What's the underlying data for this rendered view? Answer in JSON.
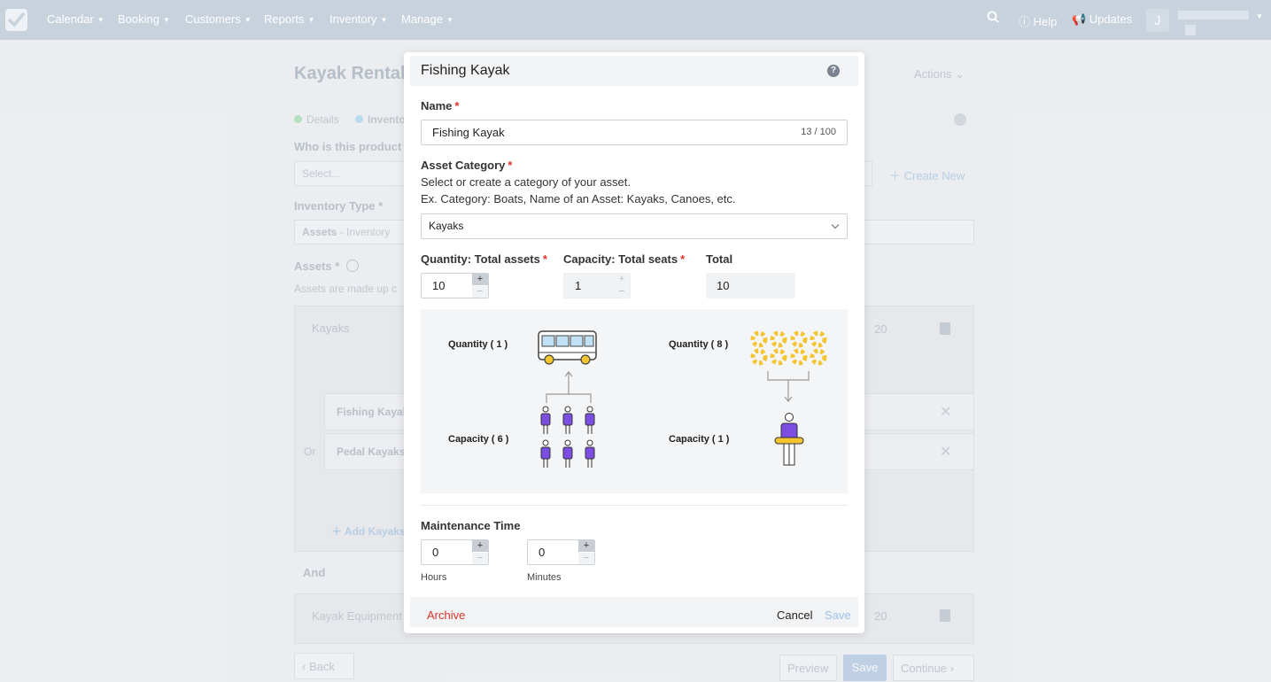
{
  "nav": {
    "items": [
      {
        "label": "Calendar"
      },
      {
        "label": "Booking"
      },
      {
        "label": "Customers"
      },
      {
        "label": "Reports"
      },
      {
        "label": "Inventory"
      },
      {
        "label": "Manage"
      }
    ],
    "help_label": "Help",
    "updates_label": "Updates",
    "user_initial": "J"
  },
  "background": {
    "title": "Kayak Rentals",
    "actions_label": "Actions",
    "steps": [
      {
        "label": "Details"
      },
      {
        "label": "Invento"
      }
    ],
    "who_label": "Who is this product",
    "select_placeholder": "Select...",
    "create_new_label": "Create New",
    "inventory_type_label": "Inventory Type *",
    "inventory_type_value": "Assets",
    "inventory_type_rest": " - Inventory",
    "assets_label": "Assets *",
    "assets_help": "Assets are made up c",
    "kayaks_group": "Kayaks",
    "kayaks_count": "20",
    "fishing_kayak": "Fishing Kayak",
    "pedal_kayaks": "Pedal Kayaks",
    "or_label": "Or",
    "add_kayaks_label": "Add Kayaks",
    "and_label": "And",
    "equipment_group": "Kayak Equipment",
    "equipment_count": "20",
    "back_label": "Back",
    "preview_label": "Preview",
    "save_label": "Save",
    "continue_label": "Continue"
  },
  "modal": {
    "title": "Fishing Kayak",
    "name_label": "Name",
    "name_value": "Fishing Kayak",
    "name_counter": "13 / 100",
    "category_label": "Asset Category",
    "category_help1": "Select or create a category of your asset.",
    "category_help2": "Ex. Category: Boats, Name of an Asset: Kayaks, Canoes, etc.",
    "category_value": "Kayaks",
    "quantity_label": "Quantity: Total assets",
    "quantity_value": "10",
    "capacity_label": "Capacity: Total seats",
    "capacity_value": "1",
    "total_label": "Total",
    "total_value": "10",
    "illustration": {
      "left_quantity": "Quantity ( 1 )",
      "left_capacity": "Capacity ( 6 )",
      "right_quantity": "Quantity ( 8 )",
      "right_capacity": "Capacity ( 1 )"
    },
    "maintenance_label": "Maintenance Time",
    "hours_value": "0",
    "minutes_value": "0",
    "hours_label": "Hours",
    "minutes_label": "Minutes",
    "archive_label": "Archive",
    "cancel_label": "Cancel",
    "save_label": "Save",
    "required_mark": "*",
    "spin_plus": "+",
    "spin_minus": "−"
  },
  "colors": {
    "nav_bg": "#c8d2dd",
    "required": "#e0322d",
    "archive": "#d9342b",
    "save_disabled": "#9ec3e8",
    "person_purple": "#7b4de0",
    "ring_yellow": "#f5c431"
  }
}
